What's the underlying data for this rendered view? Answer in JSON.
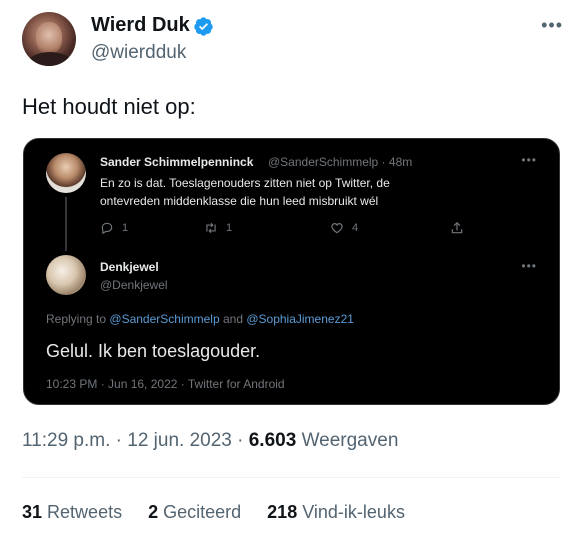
{
  "author": {
    "name": "Wierd Duk",
    "handle": "@wierdduk",
    "verified": true
  },
  "tweet": {
    "text": "Het houdt niet op:",
    "timestamp": "11:29 p.m. · 12 jun. 2023 ·",
    "views_count": "6.603",
    "views_label": "Weergaven"
  },
  "embedded_screenshot": {
    "parent_tweet": {
      "name": "Sander Schimmelpenninck",
      "handle_time": "@SanderSchimmelp · 48m",
      "text": "En zo is dat. Toeslagenouders zitten niet op Twitter, de ontevreden middenklasse die hun leed misbruikt wél",
      "reply_count": "1",
      "retweet_count": "1",
      "like_count": "4"
    },
    "reply_tweet": {
      "name": "Denkjewel",
      "handle": "@Denkjewel",
      "replying_prefix": "Replying to",
      "mention_1": "@SanderSchimmelp",
      "replying_and": "and",
      "mention_2": "@SophiaJimenez21",
      "text": "Gelul. Ik ben toeslagouder.",
      "meta": "10:23 PM · Jun 16, 2022 · Twitter for Android"
    }
  },
  "stats": {
    "retweets_count": "31",
    "retweets_label": "Retweets",
    "quotes_count": "2",
    "quotes_label": "Geciteerd",
    "likes_count": "218",
    "likes_label": "Vind-ik-leuks"
  },
  "icons": {
    "more": "more-horizontal-icon",
    "verified": "verified-badge-icon",
    "reply": "reply-icon",
    "retweet": "retweet-icon",
    "like": "like-icon",
    "share": "share-icon"
  },
  "colors": {
    "verified_blue": "#1d9bf0",
    "link_blue": "#5b9bd5",
    "embed_bg": "#000000"
  }
}
